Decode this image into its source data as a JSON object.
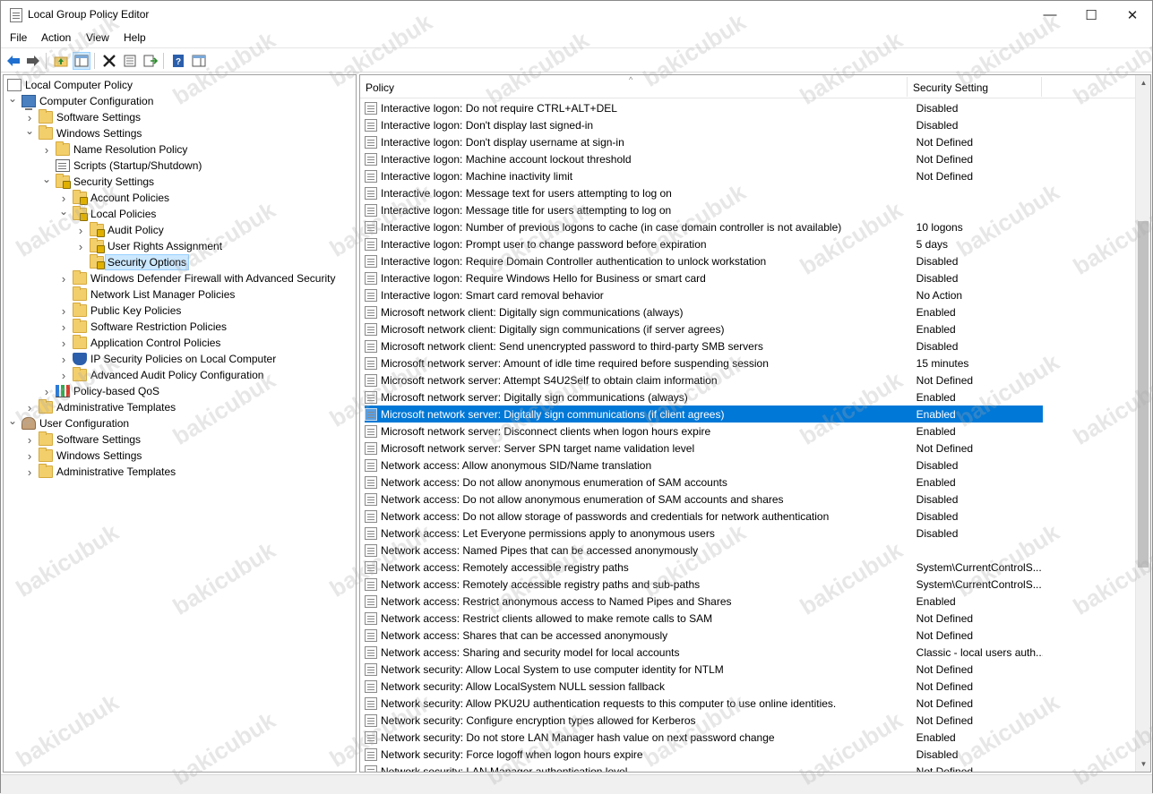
{
  "window": {
    "title": "Local Group Policy Editor",
    "controls": {
      "minimize": "—",
      "maximize": "☐",
      "close": "✕"
    }
  },
  "menu": [
    "File",
    "Action",
    "View",
    "Help"
  ],
  "toolbar": {
    "icons": [
      "back-arrow-icon",
      "forward-arrow-icon",
      "up-folder-icon",
      "show-hide-tree-icon",
      "delete-icon",
      "properties-icon",
      "export-list-icon",
      "help-icon",
      "show-hide-action-pane-icon"
    ],
    "colors": {
      "nav": "#1e6fd0",
      "delete": "#222222",
      "help": "#2b5fab"
    }
  },
  "tree": [
    {
      "label": "Local Computer Policy",
      "level": 0,
      "icon": "book",
      "arrow": ""
    },
    {
      "label": "Computer Configuration",
      "level": 0,
      "icon": "computer",
      "arrow": "expanded"
    },
    {
      "label": "Software Settings",
      "level": 1,
      "icon": "folder",
      "arrow": "collapsed"
    },
    {
      "label": "Windows Settings",
      "level": 1,
      "icon": "folder",
      "arrow": "expanded"
    },
    {
      "label": "Name Resolution Policy",
      "level": 2,
      "icon": "folder",
      "arrow": "collapsed"
    },
    {
      "label": "Scripts (Startup/Shutdown)",
      "level": 2,
      "icon": "doc",
      "arrow": ""
    },
    {
      "label": "Security Settings",
      "level": 2,
      "icon": "folder-lock",
      "arrow": "expanded"
    },
    {
      "label": "Account Policies",
      "level": 3,
      "icon": "folder-lock",
      "arrow": "collapsed"
    },
    {
      "label": "Local Policies",
      "level": 3,
      "icon": "folder-lock",
      "arrow": "expanded"
    },
    {
      "label": "Audit Policy",
      "level": 4,
      "icon": "folder-lock",
      "arrow": "collapsed"
    },
    {
      "label": "User Rights Assignment",
      "level": 4,
      "icon": "folder-lock",
      "arrow": "collapsed"
    },
    {
      "label": "Security Options",
      "level": 4,
      "icon": "folder-lock",
      "arrow": "",
      "selected": true
    },
    {
      "label": "Windows Defender Firewall with Advanced Security",
      "level": 3,
      "icon": "folder",
      "arrow": "collapsed"
    },
    {
      "label": "Network List Manager Policies",
      "level": 3,
      "icon": "folder",
      "arrow": ""
    },
    {
      "label": "Public Key Policies",
      "level": 3,
      "icon": "folder",
      "arrow": "collapsed"
    },
    {
      "label": "Software Restriction Policies",
      "level": 3,
      "icon": "folder",
      "arrow": "collapsed"
    },
    {
      "label": "Application Control Policies",
      "level": 3,
      "icon": "folder",
      "arrow": "collapsed"
    },
    {
      "label": "IP Security Policies on Local Computer",
      "level": 3,
      "icon": "shield",
      "arrow": "collapsed"
    },
    {
      "label": "Advanced Audit Policy Configuration",
      "level": 3,
      "icon": "folder",
      "arrow": "collapsed"
    },
    {
      "label": "Policy-based QoS",
      "level": 2,
      "icon": "chart",
      "arrow": "collapsed"
    },
    {
      "label": "Administrative Templates",
      "level": 1,
      "icon": "folder",
      "arrow": "collapsed"
    },
    {
      "label": "User Configuration",
      "level": 0,
      "icon": "user",
      "arrow": "expanded"
    },
    {
      "label": "Software Settings",
      "level": 1,
      "icon": "folder",
      "arrow": "collapsed"
    },
    {
      "label": "Windows Settings",
      "level": 1,
      "icon": "folder",
      "arrow": "collapsed"
    },
    {
      "label": "Administrative Templates",
      "level": 1,
      "icon": "folder",
      "arrow": "collapsed"
    }
  ],
  "list": {
    "columns": [
      "Policy",
      "Security Setting"
    ],
    "sort_indicator": "^",
    "rows": [
      [
        "Interactive logon: Do not require CTRL+ALT+DEL",
        "Disabled"
      ],
      [
        "Interactive logon: Don't display last signed-in",
        "Disabled"
      ],
      [
        "Interactive logon: Don't display username at sign-in",
        "Not Defined"
      ],
      [
        "Interactive logon: Machine account lockout threshold",
        "Not Defined"
      ],
      [
        "Interactive logon: Machine inactivity limit",
        "Not Defined"
      ],
      [
        "Interactive logon: Message text for users attempting to log on",
        ""
      ],
      [
        "Interactive logon: Message title for users attempting to log on",
        ""
      ],
      [
        "Interactive logon: Number of previous logons to cache (in case domain controller is not available)",
        "10 logons"
      ],
      [
        "Interactive logon: Prompt user to change password before expiration",
        "5 days"
      ],
      [
        "Interactive logon: Require Domain Controller authentication to unlock workstation",
        "Disabled"
      ],
      [
        "Interactive logon: Require Windows Hello for Business or smart card",
        "Disabled"
      ],
      [
        "Interactive logon: Smart card removal behavior",
        "No Action"
      ],
      [
        "Microsoft network client: Digitally sign communications (always)",
        "Enabled"
      ],
      [
        "Microsoft network client: Digitally sign communications (if server agrees)",
        "Enabled"
      ],
      [
        "Microsoft network client: Send unencrypted password to third-party SMB servers",
        "Disabled"
      ],
      [
        "Microsoft network server: Amount of idle time required before suspending session",
        "15 minutes"
      ],
      [
        "Microsoft network server: Attempt S4U2Self to obtain claim information",
        "Not Defined"
      ],
      [
        "Microsoft network server: Digitally sign communications (always)",
        "Enabled"
      ],
      [
        "Microsoft network server: Digitally sign communications (if client agrees)",
        "Enabled"
      ],
      [
        "Microsoft network server: Disconnect clients when logon hours expire",
        "Enabled"
      ],
      [
        "Microsoft network server: Server SPN target name validation level",
        "Not Defined"
      ],
      [
        "Network access: Allow anonymous SID/Name translation",
        "Disabled"
      ],
      [
        "Network access: Do not allow anonymous enumeration of SAM accounts",
        "Enabled"
      ],
      [
        "Network access: Do not allow anonymous enumeration of SAM accounts and shares",
        "Disabled"
      ],
      [
        "Network access: Do not allow storage of passwords and credentials for network authentication",
        "Disabled"
      ],
      [
        "Network access: Let Everyone permissions apply to anonymous users",
        "Disabled"
      ],
      [
        "Network access: Named Pipes that can be accessed anonymously",
        ""
      ],
      [
        "Network access: Remotely accessible registry paths",
        "System\\CurrentControlS..."
      ],
      [
        "Network access: Remotely accessible registry paths and sub-paths",
        "System\\CurrentControlS..."
      ],
      [
        "Network access: Restrict anonymous access to Named Pipes and Shares",
        "Enabled"
      ],
      [
        "Network access: Restrict clients allowed to make remote calls to SAM",
        "Not Defined"
      ],
      [
        "Network access: Shares that can be accessed anonymously",
        "Not Defined"
      ],
      [
        "Network access: Sharing and security model for local accounts",
        "Classic - local users auth..."
      ],
      [
        "Network security: Allow Local System to use computer identity for NTLM",
        "Not Defined"
      ],
      [
        "Network security: Allow LocalSystem NULL session fallback",
        "Not Defined"
      ],
      [
        "Network security: Allow PKU2U authentication requests to this computer to use online identities.",
        "Not Defined"
      ],
      [
        "Network security: Configure encryption types allowed for Kerberos",
        "Not Defined"
      ],
      [
        "Network security: Do not store LAN Manager hash value on next password change",
        "Enabled"
      ],
      [
        "Network security: Force logoff when logon hours expire",
        "Disabled"
      ],
      [
        "Network security: LAN Manager authentication level",
        "Not Defined"
      ]
    ],
    "selected_row": 18,
    "selection_color": "#0078d7"
  },
  "scrollbar": {
    "position": 0.41,
    "visible_fraction": 0.52
  },
  "watermark": "bakicubuk"
}
